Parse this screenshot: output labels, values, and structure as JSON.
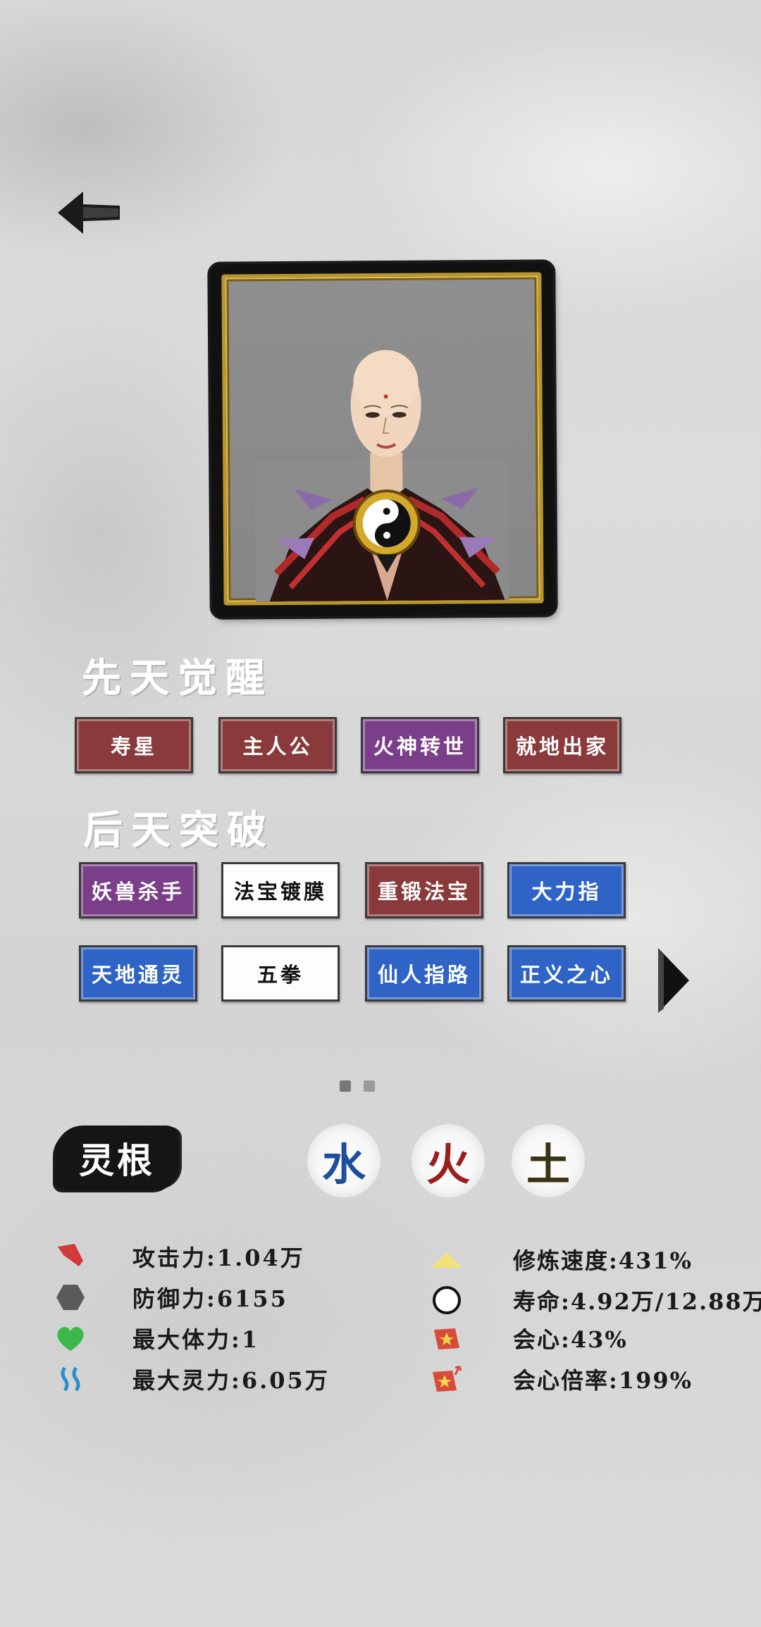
{
  "nav": {
    "back_icon": "back-arrow-icon"
  },
  "portrait": {
    "character": "bald monk with taiji amulet and red-black armored shoulders"
  },
  "innate": {
    "title": "先天觉醒",
    "traits": [
      {
        "label": "寿星",
        "color": "red"
      },
      {
        "label": "主人公",
        "color": "red"
      },
      {
        "label": "火神转世",
        "color": "purple"
      },
      {
        "label": "就地出家",
        "color": "red"
      }
    ]
  },
  "acquired": {
    "title": "后天突破",
    "traits": [
      {
        "label": "妖兽杀手",
        "color": "purple"
      },
      {
        "label": "法宝镀膜",
        "color": "white"
      },
      {
        "label": "重锻法宝",
        "color": "red"
      },
      {
        "label": "大力指",
        "color": "blue"
      },
      {
        "label": "天地通灵",
        "color": "blue"
      },
      {
        "label": "五拳",
        "color": "white"
      },
      {
        "label": "仙人指路",
        "color": "blue"
      },
      {
        "label": "正义之心",
        "color": "blue"
      }
    ],
    "next_icon": "next-page-triangle-icon",
    "pages": 2,
    "current_page": 1
  },
  "spirit_root": {
    "label": "灵根",
    "elements": [
      "水",
      "火",
      "土"
    ]
  },
  "stats": {
    "attack": "攻击力:1.04万",
    "defense": "防御力:6155",
    "max_hp": "最大体力:1",
    "max_mana": "最大灵力:6.05万",
    "cultivation_speed": "修炼速度:431%",
    "lifespan": "寿命:4.92万/12.88万",
    "crit": "会心:43%",
    "crit_multiplier": "会心倍率:199%"
  },
  "colors": {
    "trait_red": "#8a3a3a",
    "trait_purple": "#7b3f8a",
    "trait_blue": "#2f63c6",
    "water": "#1d4f9b",
    "fire": "#9b1f1f",
    "earth": "#3a3414",
    "frame_gold": "#b8962e"
  }
}
